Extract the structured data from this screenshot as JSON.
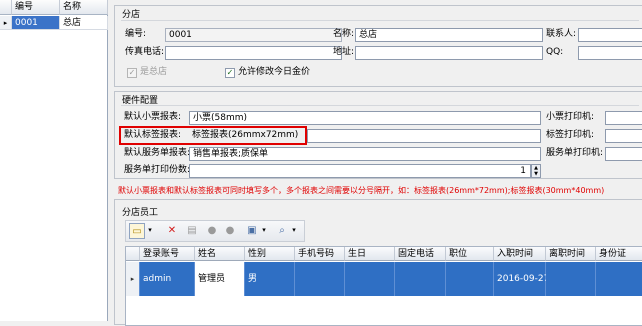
{
  "left_grid": {
    "columns": [
      "编号",
      "名称"
    ],
    "rows": [
      {
        "code": "0001",
        "name": "总店"
      }
    ]
  },
  "store": {
    "group_title": "分店",
    "code_label": "编号:",
    "code_value": "0001",
    "name_label": "名称:",
    "name_value": "总店",
    "contact_label": "联系人:",
    "fax_label": "传真电话:",
    "address_label": "地址:",
    "qq_label": "QQ:",
    "is_head_label": "是总店",
    "allow_modify_label": "允许修改今日金价"
  },
  "hardware": {
    "group_title": "硬件配置",
    "receipt_report_label": "默认小票报表:",
    "receipt_report_value": "小票(58mm)",
    "tag_report_label": "默认标签报表:",
    "tag_report_value": "标签报表(26mmx72mm)",
    "service_report_label": "默认服务单报表:",
    "service_report_value": "销售单报表;质保单",
    "print_copies_label": "服务单打印份数:",
    "print_copies_value": "1",
    "receipt_printer_label": "小票打印机:",
    "tag_printer_label": "标签打印机:",
    "service_printer_label": "服务单打印机:"
  },
  "hint": "默认小票报表和默认标签报表可同时填写多个，多个报表之间需要以分号隔开，如：标签报表(26mm*72mm);标签报表(30mm*40mm)",
  "staff": {
    "group_title": "分店员工",
    "columns": [
      "登录账号",
      "姓名",
      "性别",
      "手机号码",
      "生日",
      "固定电话",
      "职位",
      "入职时间",
      "离职时间",
      "身份证"
    ],
    "rows": [
      {
        "account": "admin",
        "name": "管理员",
        "gender": "男",
        "phone": "",
        "birthday": "",
        "tel": "",
        "position": "",
        "hire_date": "2016-09-27",
        "leave_date": "",
        "id_card": ""
      }
    ]
  },
  "colors": {
    "highlight_box": "#e00000",
    "selection": "#2f6fc4",
    "hint_text": "#e00000"
  }
}
